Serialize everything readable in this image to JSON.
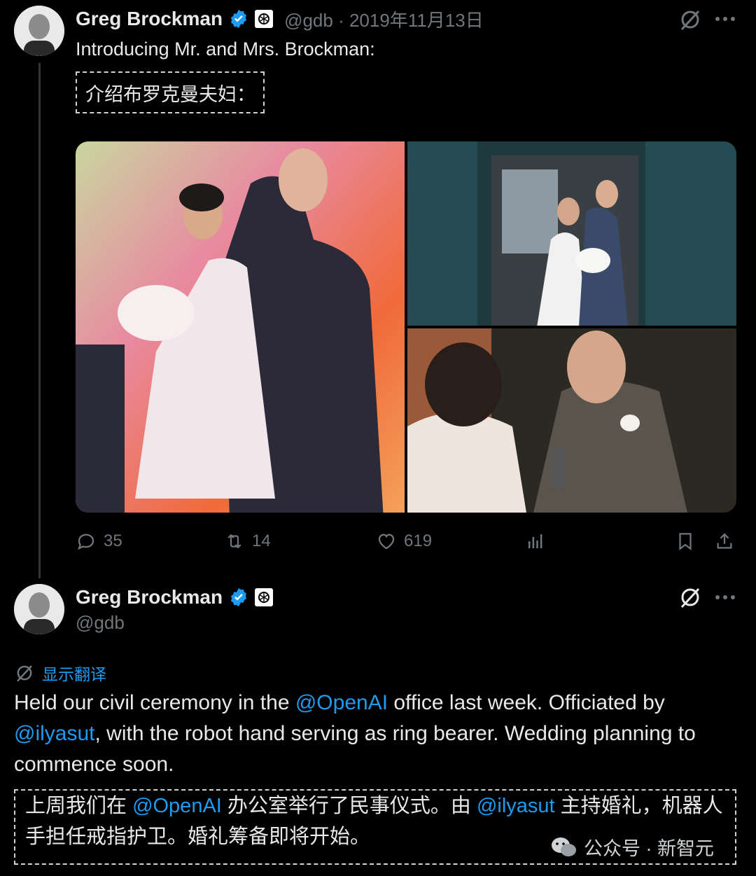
{
  "tweet1": {
    "author": "Greg Brockman",
    "handle_date": "@gdb · 2019年11月13日",
    "text": "Introducing Mr. and Mrs. Brockman:",
    "translation": "介绍布罗克曼夫妇：",
    "stats": {
      "replies": "35",
      "retweets": "14",
      "likes": "619"
    }
  },
  "tweet2": {
    "author": "Greg Brockman",
    "handle": "@gdb",
    "show_translation": "显示翻译",
    "text_parts": {
      "p1": "Held our civil ceremony in the ",
      "m1": "@OpenAI",
      "p2": " office last week. Officiated by ",
      "m2": "@ilyasut",
      "p3": ", with the robot hand serving as ring bearer. Wedding planning to commence soon."
    },
    "translation_parts": {
      "p1": "上周我们在 ",
      "m1": "@OpenAI",
      "p2": " 办公室举行了民事仪式。由 ",
      "m2": "@ilyasut",
      "p3": " 主持婚礼，机器人手担任戒指护卫。婚礼筹备即将开始。"
    }
  },
  "watermark": "公众号 · 新智元",
  "colors": {
    "accent": "#1d9bf0",
    "muted": "#71767b",
    "background": "#000000",
    "text": "#e7e9ea"
  },
  "icons": [
    "verified-badge-icon",
    "openai-logo-icon",
    "grok-icon",
    "more-icon",
    "reply-icon",
    "retweet-icon",
    "like-icon",
    "views-icon",
    "bookmark-icon",
    "share-icon",
    "translate-icon",
    "wechat-icon"
  ]
}
